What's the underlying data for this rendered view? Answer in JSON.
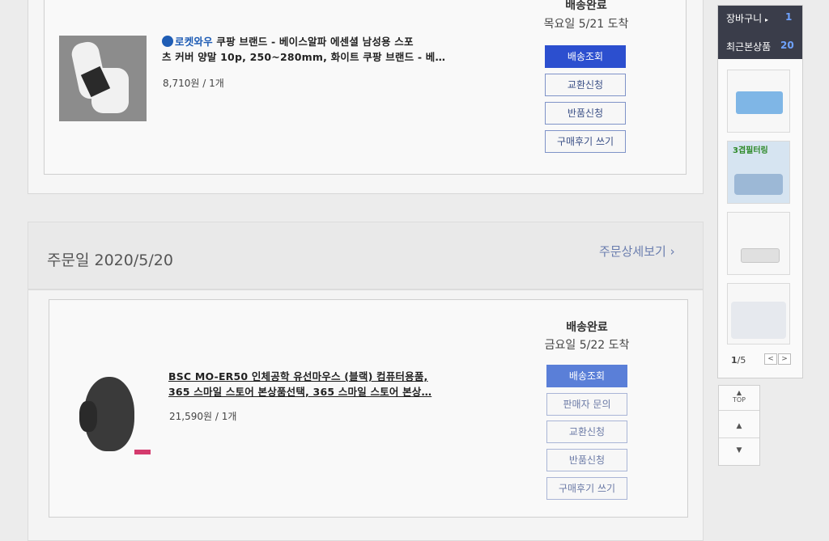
{
  "order1": {
    "rocket_label": "로켓와우",
    "product_line1": "쿠팡 브랜드 - 베이스알파 에센셜 남성용 스포",
    "product_line2": "츠 커버 양말 10p, 250~280mm, 화이트 쿠팡 브랜드 - 베…",
    "price": "8,710원 / 1개",
    "status": "배송완료",
    "eta": "목요일 5/21 도착",
    "buttons": [
      "배송조회",
      "교환신청",
      "반품신청",
      "구매후기 쓰기"
    ]
  },
  "order2": {
    "order_date": "주문일 2020/5/20",
    "detail_link": "주문상세보기",
    "product_line1": "BSC MO-ER50 인체공학 유선마우스 (블랙) 컴퓨터용품,",
    "product_line2": "365 스마일 스토어 본상품선택, 365 스마일 스토어 본상…",
    "price": "21,590원 / 1개",
    "status": "배송완료",
    "eta": "금요일 5/22 도착",
    "buttons": [
      "배송조회",
      "판매자 문의",
      "교환신청",
      "반품신청",
      "구매후기 쓰기"
    ]
  },
  "sidebar": {
    "cart_label": "장바구니",
    "cart_count": "1",
    "recent_label": "최근본상품",
    "recent_count": "20",
    "thumb2_text": "3겹필터링",
    "page_current": "1",
    "page_total": "/5",
    "prev": "<",
    "next": ">"
  },
  "scroll": {
    "top_label": "TOP"
  },
  "colors": {
    "primary": "#2c4fcf",
    "link": "#6a7dae",
    "sidebar_bg": "#3a3d4a"
  },
  "icons": [
    "cart-arrow-icon",
    "rocket-wow-icon",
    "chevron-right-icon",
    "up-icon",
    "down-icon"
  ]
}
